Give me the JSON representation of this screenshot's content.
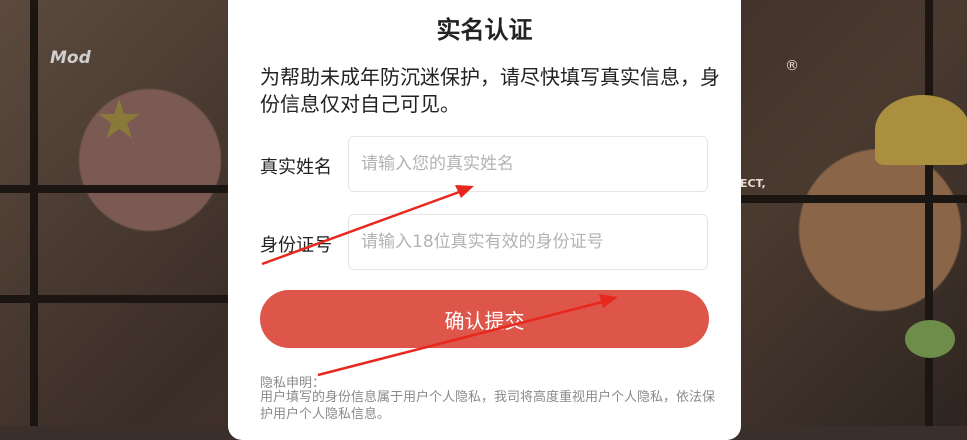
{
  "background": {
    "mod_logo": "Mod",
    "registered_mark": "®",
    "partial_text": "ECT,"
  },
  "dialog": {
    "title": "实名认证",
    "intro": "为帮助未成年防沉迷保护，请尽快填写真实信息，身份信息仅对自己可见。",
    "name_label": "真实姓名",
    "name_placeholder": "请输入您的真实姓名",
    "id_label": "身份证号",
    "id_placeholder": "请输入18位真实有效的身份证号",
    "submit_label": "确认提交",
    "privacy_title": "隐私申明：",
    "privacy_text": "用户填写的身份信息属于用户个人隐私，我司将高度重视用户个人隐私，依法保护用户个人隐私信息。"
  },
  "colors": {
    "accent": "#de5549",
    "annotation_arrow": "#e8281e"
  },
  "icons": [
    "star-icon",
    "arrow-annotation"
  ]
}
